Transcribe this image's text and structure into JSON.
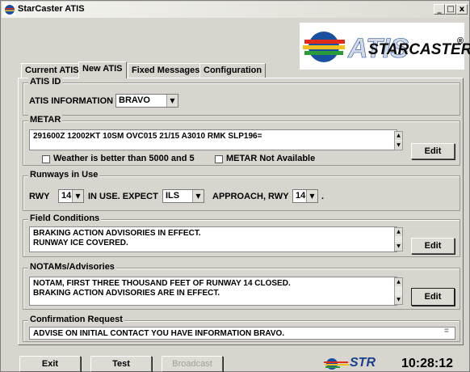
{
  "window": {
    "title": "StarCaster ATIS",
    "controls": [
      "_",
      "□",
      "x"
    ]
  },
  "logo": {
    "text": "STARCASTER",
    "registered": "®",
    "brand_colors": {
      "blue": "#1a4fa0",
      "red": "#e02a1a",
      "yellow": "#f0c020",
      "green": "#2a9a3a"
    }
  },
  "tabs": [
    {
      "label": "Current ATIS",
      "active": false
    },
    {
      "label": "New ATIS",
      "active": true
    },
    {
      "label": "Fixed Messages",
      "active": false
    },
    {
      "label": "Configuration",
      "active": false
    }
  ],
  "atis_id": {
    "group_label": "ATIS ID",
    "field_label": "ATIS INFORMATION",
    "value": "BRAVO"
  },
  "metar": {
    "group_label": "METAR",
    "text": "291600Z 12002KT 10SM OVC015 21/15 A3010 RMK SLP196=",
    "checkbox1_label": "Weather is better than 5000 and 5",
    "checkbox2_label": "METAR Not Available",
    "edit_label": "Edit"
  },
  "runways": {
    "group_label": "Runways in Use",
    "rwy_label": "RWY",
    "rwy_value": "14",
    "in_use_label": "IN USE. EXPECT",
    "approach_value": "ILS",
    "approach_label": "APPROACH, RWY",
    "approach_rwy_value": "14",
    "period": "."
  },
  "field_conditions": {
    "group_label": "Field Conditions",
    "text": "BRAKING ACTION ADVISORIES IN EFFECT.\nRUNWAY ICE COVERED.",
    "edit_label": "Edit"
  },
  "notams": {
    "group_label": "NOTAMs/Advisories",
    "text": "NOTAM, FIRST THREE THOUSAND FEET OF RUNWAY 14 CLOSED.\nBRAKING ACTION ADVISORIES ARE IN EFFECT.",
    "edit_label": "Edit"
  },
  "confirmation": {
    "group_label": "Confirmation Request",
    "text": "ADVISE ON INITIAL CONTACT YOU HAVE INFORMATION BRAVO."
  },
  "bottom": {
    "exit_label": "Exit",
    "test_label": "Test",
    "broadcast_label": "Broadcast",
    "str_logo": "STR",
    "clock": "10:28:12"
  }
}
